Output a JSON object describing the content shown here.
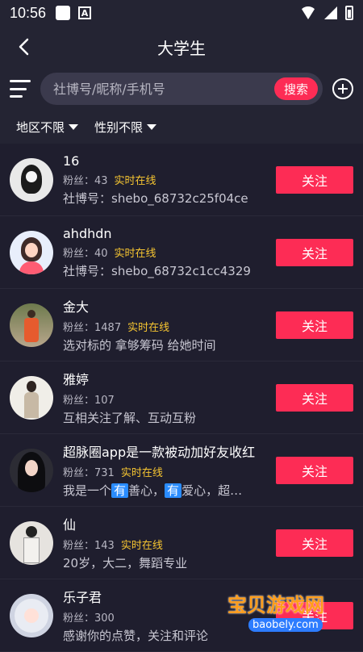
{
  "status_bar": {
    "time": "10:56"
  },
  "header": {
    "title": "大学生"
  },
  "search": {
    "placeholder": "社博号/昵称/手机号",
    "button_label": "搜索"
  },
  "filters": [
    {
      "label": "地区不限"
    },
    {
      "label": "性别不限"
    }
  ],
  "users": [
    {
      "name": "16",
      "fans": "粉丝：43",
      "status": "实时在线",
      "bio": "社博号：shebo_68732c25f04ce",
      "button": "关注"
    },
    {
      "name": "ahdhdn",
      "fans": "粉丝：40",
      "status": "实时在线",
      "bio": "社博号：shebo_68732c1cc4329",
      "button": "关注"
    },
    {
      "name": "金大",
      "fans": "粉丝：1487",
      "status": "实时在线",
      "bio": "选对标的 拿够筹码 给她时间",
      "button": "关注"
    },
    {
      "name": "雅婷",
      "fans": "粉丝：107",
      "status": "",
      "bio": "互相关注了解、互动互粉",
      "button": "关注"
    },
    {
      "name": "超脉圈app是一款被动加好友收红",
      "fans": "粉丝：731",
      "status": "实时在线",
      "bio_parts": [
        "我是一个",
        "有",
        "善心，",
        "有",
        "爱心，超…"
      ],
      "button": "关注"
    },
    {
      "name": "仙",
      "fans": "粉丝：143",
      "status": "实时在线",
      "bio": "20岁，大二，舞蹈专业",
      "button": "关注"
    },
    {
      "name": "乐子君",
      "fans": "粉丝：300",
      "status": "",
      "bio": "感谢你的点赞，关注和评论",
      "button": "关注"
    }
  ],
  "watermark": {
    "brand": "宝贝游戏网",
    "url": "baobely.com"
  }
}
